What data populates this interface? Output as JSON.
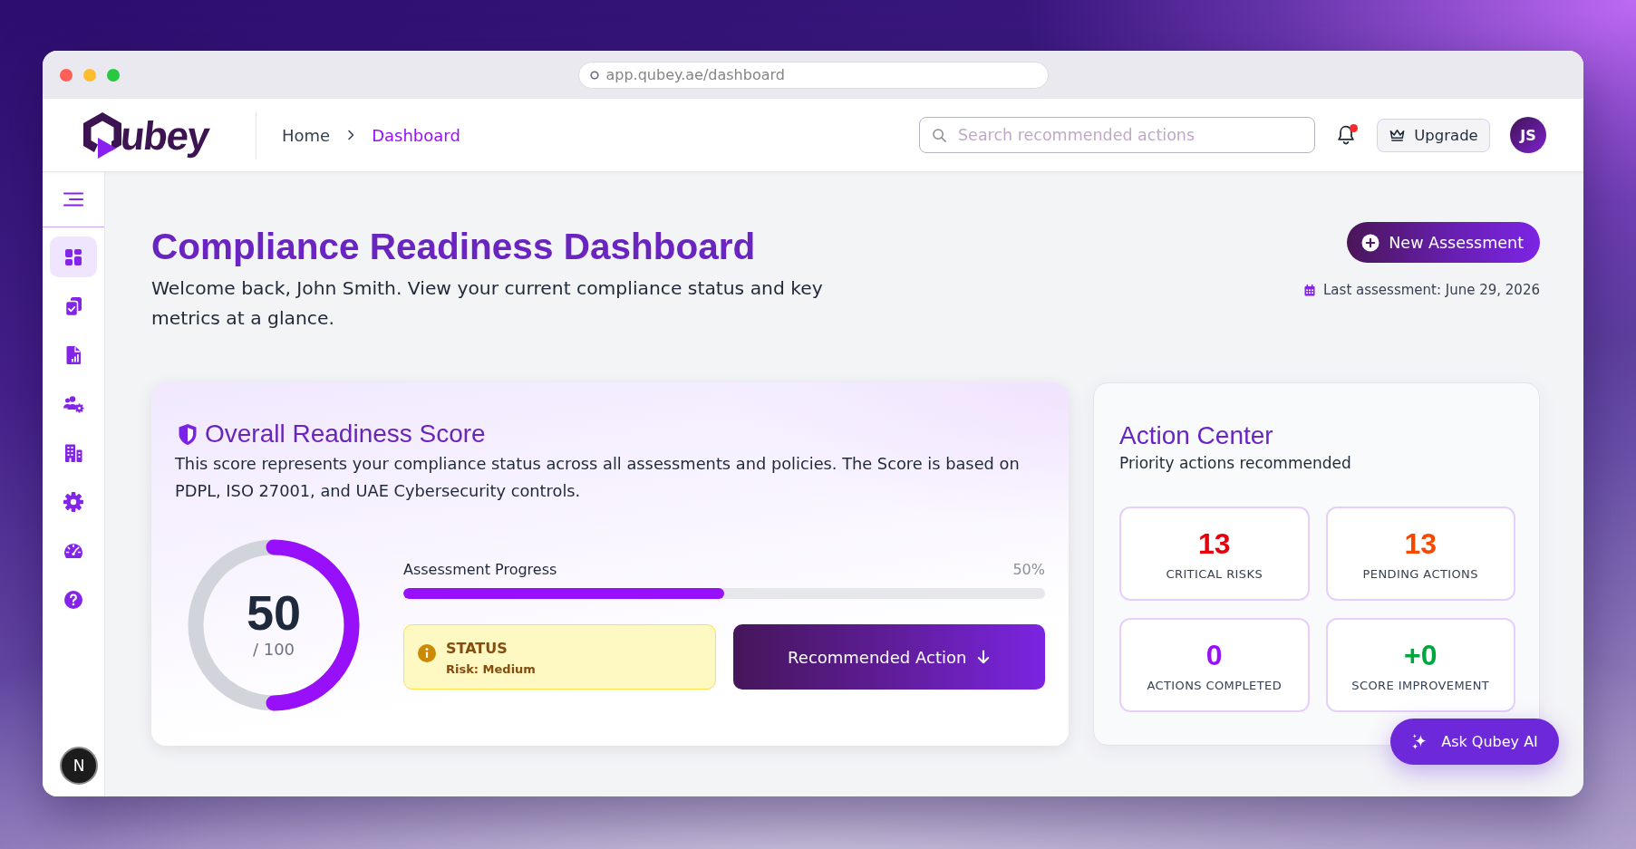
{
  "browser": {
    "url": "app.qubey.ae/dashboard"
  },
  "header": {
    "brand": "ubey",
    "breadcrumb": [
      {
        "label": "Home",
        "selected": false
      },
      {
        "label": "Dashboard",
        "selected": true
      }
    ],
    "search": {
      "placeholder": "Search recommended actions"
    },
    "notifications": {
      "unread": true
    },
    "upgrade_button": "Upgrade",
    "avatar": "JS"
  },
  "sidebar": {
    "items": [
      {
        "selected": true
      },
      {
        "selected": false
      },
      {
        "selected": false
      },
      {
        "selected": false
      },
      {
        "selected": false
      },
      {
        "selected": false
      },
      {
        "selected": false
      },
      {
        "selected": false
      }
    ]
  },
  "corner_badge": "N",
  "page": {
    "title": "Compliance Readiness Dashboard",
    "subtitle": "Welcome back, John Smith. View your current compliance status and key metrics at a glance.",
    "new_button": "New Assessment",
    "last_assessment": "Last assessment: June 29, 2026"
  },
  "score_card": {
    "title": "Overall Readiness Score",
    "description": "This score represents your compliance status across all assessments and policies. The Score is based on PDPL, ISO 27001, and UAE Cybersecurity controls.",
    "gauge": {
      "value": "50",
      "max": "/ 100",
      "level": 0.5
    },
    "progress": {
      "label": "Assessment Progress",
      "reading": "50%",
      "level": 0.5
    },
    "status": {
      "title": "STATUS",
      "detail": "Risk: Medium"
    },
    "action_button": "Recommended Action"
  },
  "action_center": {
    "title": "Action Center",
    "subtitle": "Priority actions recommended",
    "stats": [
      {
        "value": "13",
        "label": "CRITICAL RISKS",
        "color": "#e7000b"
      },
      {
        "value": "13",
        "label": "PENDING ACTIONS",
        "color": "#f54900"
      },
      {
        "value": "0",
        "label": "ACTIONS COMPLETED",
        "color": "#9810fa"
      },
      {
        "value": "+0",
        "label": "SCORE IMPROVEMENT",
        "color": "#00a63e"
      }
    ]
  },
  "assistant_button": "Ask Qubey AI"
}
